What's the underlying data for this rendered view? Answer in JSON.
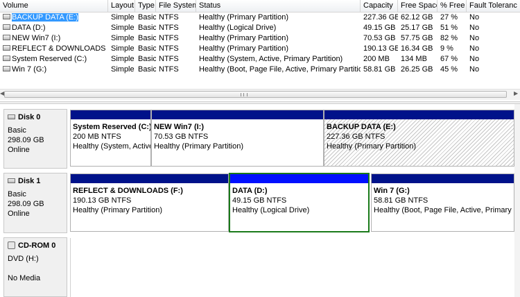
{
  "columns": [
    "Volume",
    "Layout",
    "Type",
    "File System",
    "Status",
    "Capacity",
    "Free Space",
    "% Free",
    "Fault Toleranc"
  ],
  "volumes": [
    {
      "name": "BACKUP DATA (E:)",
      "layout": "Simple",
      "type": "Basic",
      "fs": "NTFS",
      "status": "Healthy (Primary Partition)",
      "capacity": "227.36 GB",
      "free": "62.12 GB",
      "pct": "27 %",
      "fault": "No"
    },
    {
      "name": "DATA (D:)",
      "layout": "Simple",
      "type": "Basic",
      "fs": "NTFS",
      "status": "Healthy (Logical Drive)",
      "capacity": "49.15 GB",
      "free": "25.17 GB",
      "pct": "51 %",
      "fault": "No"
    },
    {
      "name": "NEW Win7 (I:)",
      "layout": "Simple",
      "type": "Basic",
      "fs": "NTFS",
      "status": "Healthy (Primary Partition)",
      "capacity": "70.53 GB",
      "free": "57.75 GB",
      "pct": "82 %",
      "fault": "No"
    },
    {
      "name": "REFLECT & DOWNLOADS (F:)",
      "layout": "Simple",
      "type": "Basic",
      "fs": "NTFS",
      "status": "Healthy (Primary Partition)",
      "capacity": "190.13 GB",
      "free": "16.34 GB",
      "pct": "9 %",
      "fault": "No"
    },
    {
      "name": "System Reserved (C:)",
      "layout": "Simple",
      "type": "Basic",
      "fs": "NTFS",
      "status": "Healthy (System, Active, Primary Partition)",
      "capacity": "200 MB",
      "free": "134 MB",
      "pct": "67 %",
      "fault": "No"
    },
    {
      "name": "Win 7 (G:)",
      "layout": "Simple",
      "type": "Basic",
      "fs": "NTFS",
      "status": "Healthy (Boot, Page File, Active, Primary Partition)",
      "capacity": "58.81 GB",
      "free": "26.25 GB",
      "pct": "45 %",
      "fault": "No"
    }
  ],
  "disks": [
    {
      "name": "Disk 0",
      "type": "Basic",
      "size": "298.09 GB",
      "state": "Online",
      "icon": "disk-icon",
      "partitions": [
        {
          "title": "System Reserved  (C:)",
          "size": "200 MB NTFS",
          "status": "Healthy (System, Active"
        },
        {
          "title": "NEW Win7  (I:)",
          "size": "70.53 GB NTFS",
          "status": "Healthy (Primary Partition)"
        },
        {
          "title": "BACKUP DATA  (E:)",
          "size": "227.36 GB NTFS",
          "status": "Healthy (Primary Partition)"
        }
      ]
    },
    {
      "name": "Disk 1",
      "type": "Basic",
      "size": "298.09 GB",
      "state": "Online",
      "icon": "disk-icon",
      "partitions": [
        {
          "title": "REFLECT & DOWNLOADS  (F:)",
          "size": "190.13 GB NTFS",
          "status": "Healthy (Primary Partition)"
        },
        {
          "title": "DATA  (D:)",
          "size": "49.15 GB NTFS",
          "status": "Healthy (Logical Drive)"
        },
        {
          "title": "Win 7  (G:)",
          "size": "58.81 GB NTFS",
          "status": "Healthy (Boot, Page File, Active, Primary Par"
        }
      ]
    }
  ],
  "cdrom": {
    "name": "CD-ROM 0",
    "drive": "DVD (H:)",
    "media": "No Media",
    "icon": "cdrom-icon"
  },
  "colors": {
    "partition_header": "#00128a",
    "selected_header": "#0010ff",
    "selection": "#3399ff",
    "active_border": "#1a7a1a"
  }
}
